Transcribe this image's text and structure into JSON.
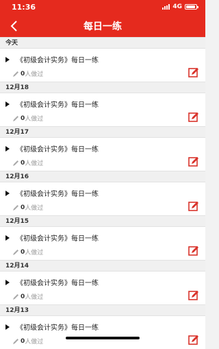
{
  "status_bar": {
    "time": "11:36",
    "network": "4G"
  },
  "header": {
    "title": "每日一练"
  },
  "groups": [
    {
      "date": "今天",
      "item": {
        "title": "《初级会计实务》每日一练",
        "count": "0",
        "suffix": "人做过"
      }
    },
    {
      "date": "12月18",
      "item": {
        "title": "《初级会计实务》每日一练",
        "count": "0",
        "suffix": "人做过"
      }
    },
    {
      "date": "12月17",
      "item": {
        "title": "《初级会计实务》每日一练",
        "count": "0",
        "suffix": "人做过"
      }
    },
    {
      "date": "12月16",
      "item": {
        "title": "《初级会计实务》每日一练",
        "count": "0",
        "suffix": "人做过"
      }
    },
    {
      "date": "12月15",
      "item": {
        "title": "《初级会计实务》每日一练",
        "count": "0",
        "suffix": "人做过"
      }
    },
    {
      "date": "12月14",
      "item": {
        "title": "《初级会计实务》每日一练",
        "count": "0",
        "suffix": "人做过"
      }
    },
    {
      "date": "12月13",
      "item": {
        "title": "《初级会计实务》每日一练",
        "count": "0",
        "suffix": "人做过"
      }
    }
  ],
  "colors": {
    "accent": "#e52a1e",
    "edit": "#d9332b"
  },
  "icons": {
    "back": "chevron-left-icon",
    "pencil": "pencil-icon",
    "edit": "edit-square-icon"
  }
}
